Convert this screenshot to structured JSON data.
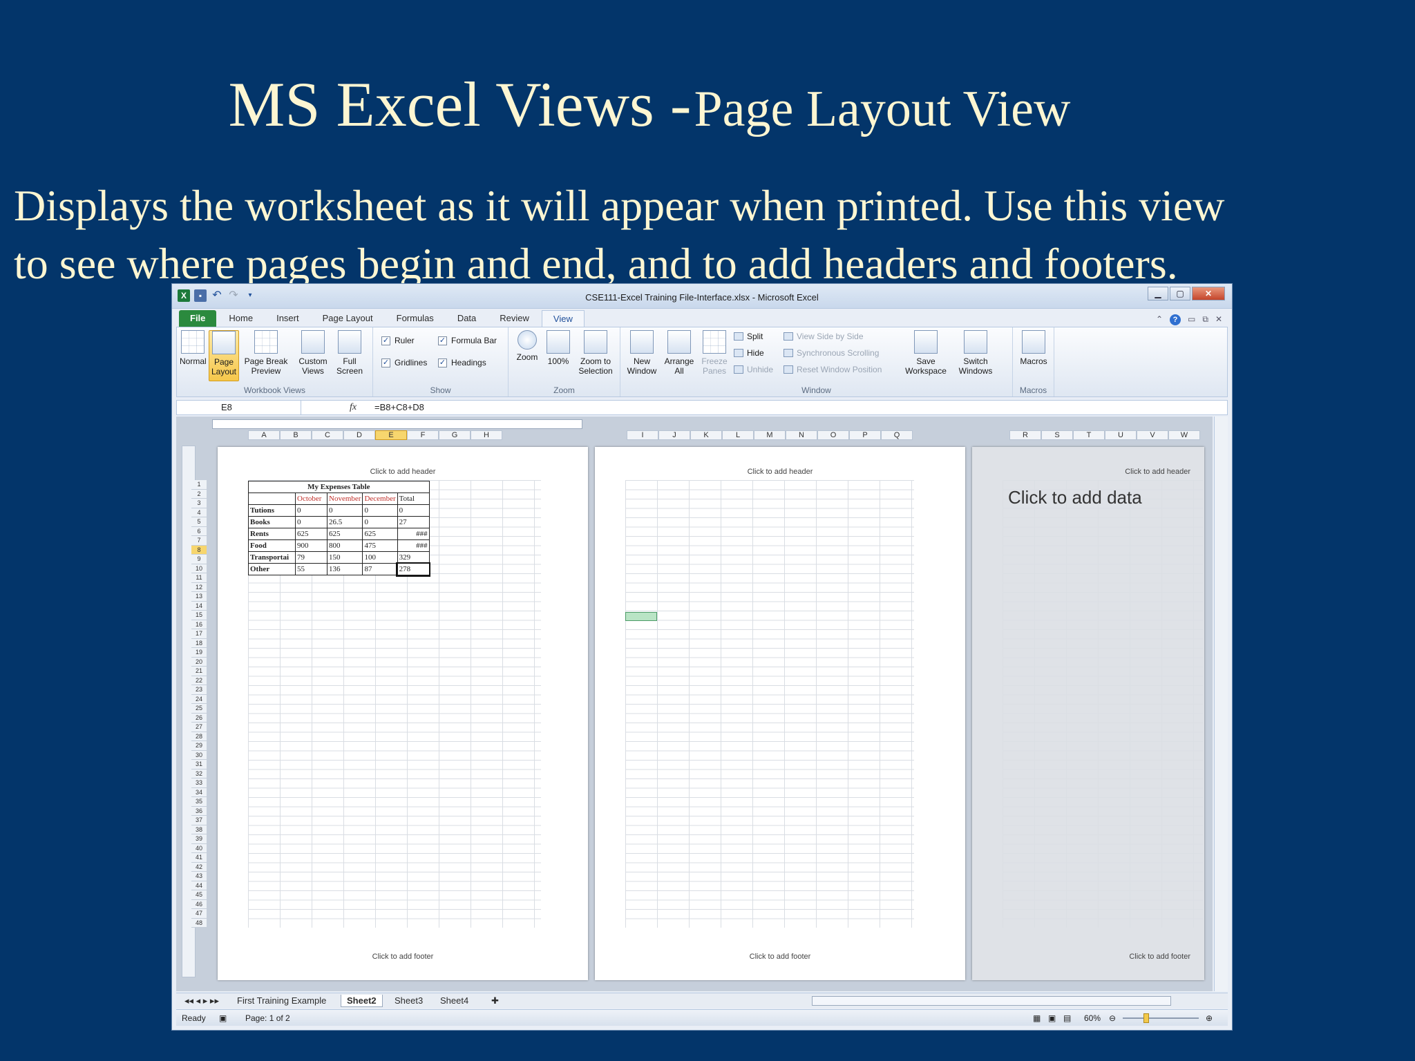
{
  "slide": {
    "title_big": "MS Excel Views -",
    "title_small": "Page Layout View",
    "body_line1": "Displays the worksheet as it will appear when printed. Use this view",
    "body_line2": "to see where pages begin and end, and to add headers and footers."
  },
  "window": {
    "title": "CSE111-Excel Training File-Interface.xlsx  -  Microsoft Excel",
    "icons": [
      "excel-logo-icon",
      "save-icon",
      "undo-icon",
      "redo-icon",
      "customize-qat-icon"
    ]
  },
  "ribbon_tabs": [
    "File",
    "Home",
    "Insert",
    "Page Layout",
    "Formulas",
    "Data",
    "Review",
    "View"
  ],
  "active_tab": "View",
  "ribbon": {
    "workbook_views": {
      "label": "Workbook Views",
      "normal": "Normal",
      "page_layout_1": "Page",
      "page_layout_2": "Layout",
      "page_break_1": "Page Break",
      "page_break_2": "Preview",
      "custom_1": "Custom",
      "custom_2": "Views",
      "full_1": "Full",
      "full_2": "Screen"
    },
    "show": {
      "label": "Show",
      "ruler": "Ruler",
      "formula_bar": "Formula Bar",
      "gridlines": "Gridlines",
      "headings": "Headings"
    },
    "zoom": {
      "label": "Zoom",
      "zoom": "Zoom",
      "hundred": "100%",
      "zoom_sel_1": "Zoom to",
      "zoom_sel_2": "Selection"
    },
    "window": {
      "label": "Window",
      "new_1": "New",
      "new_2": "Window",
      "arrange_1": "Arrange",
      "arrange_2": "All",
      "freeze_1": "Freeze",
      "freeze_2": "Panes",
      "split": "Split",
      "hide": "Hide",
      "unhide": "Unhide",
      "side_by_side": "View Side by Side",
      "sync_scroll": "Synchronous Scrolling",
      "reset_pos": "Reset Window Position",
      "save_1": "Save",
      "save_2": "Workspace",
      "switch_1": "Switch",
      "switch_2": "Windows"
    },
    "macros": {
      "label": "Macros",
      "macros": "Macros"
    }
  },
  "formula_bar": {
    "name_box": "E8",
    "fx": "fx",
    "formula": "=B8+C8+D8"
  },
  "columns_page1": [
    "A",
    "B",
    "C",
    "D",
    "E",
    "F",
    "G",
    "H"
  ],
  "columns_page2": [
    "I",
    "J",
    "K",
    "L",
    "M",
    "N",
    "O",
    "P",
    "Q"
  ],
  "columns_page3": [
    "R",
    "S",
    "T",
    "U",
    "V",
    "W"
  ],
  "selected_column": "E",
  "rows": [
    "1",
    "2",
    "3",
    "4",
    "5",
    "6",
    "7",
    "8",
    "9",
    "10",
    "11",
    "12",
    "13",
    "14",
    "15",
    "16",
    "17",
    "18",
    "19",
    "20",
    "21",
    "22",
    "23",
    "24",
    "25",
    "26",
    "27",
    "28",
    "29",
    "30",
    "31",
    "32",
    "33",
    "34",
    "35",
    "36",
    "37",
    "38",
    "39",
    "40",
    "41",
    "42",
    "43",
    "44",
    "45",
    "46",
    "47",
    "48"
  ],
  "selected_row": "8",
  "page_header": "Click to add header",
  "page_footer": "Click to add footer",
  "click_to_add_data": "Click to add data",
  "expenses_table": {
    "title": "My Expenses Table",
    "headers": [
      "",
      "October",
      "November",
      "December",
      "Total"
    ],
    "rows": [
      [
        "Tutions",
        "0",
        "0",
        "0",
        "0"
      ],
      [
        "Books",
        "0",
        "26.5",
        "0",
        "27"
      ],
      [
        "Rents",
        "625",
        "625",
        "625",
        "###"
      ],
      [
        "Food",
        "900",
        "800",
        "475",
        "###"
      ],
      [
        "Transportai",
        "79",
        "150",
        "100",
        "329"
      ],
      [
        "Other",
        "55",
        "136",
        "87",
        "278"
      ]
    ]
  },
  "sheet_tabs": [
    "First Training Example",
    "Sheet2",
    "Sheet3",
    "Sheet4"
  ],
  "active_sheet": "Sheet2",
  "status": {
    "ready": "Ready",
    "page": "Page: 1 of 2",
    "zoom": "60%"
  }
}
